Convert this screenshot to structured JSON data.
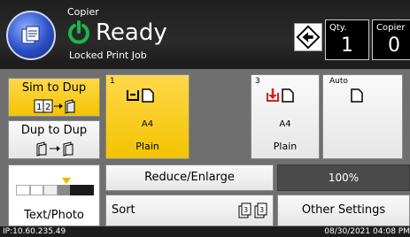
{
  "header": {
    "app_title": "Copier",
    "status": "Ready",
    "sub_status": "Locked Print Job",
    "qty_label": "Qty.",
    "qty_value": "1",
    "copier_label": "Copier",
    "copier_value": "0"
  },
  "duplex": {
    "sim_label": "Sim to Dup",
    "dup_label": "Dup to Dup"
  },
  "trays": [
    {
      "number": "1",
      "size": "A4",
      "type": "Plain"
    },
    {
      "number": "3",
      "size": "A4",
      "type": "Plain"
    },
    {
      "label": "Auto"
    }
  ],
  "density": {
    "label": "Text/Photo",
    "colors": [
      "#ffffff",
      "#ffffff",
      "#f0f0f0",
      "#8a8a8a",
      "#1a1a1a",
      "#1a1a1a"
    ]
  },
  "reduce_enlarge": {
    "label": "Reduce/Enlarge",
    "zoom": "100%"
  },
  "sort": {
    "label": "Sort"
  },
  "other": {
    "label": "Other Settings"
  },
  "statusbar": {
    "ip": "IP:10.60.235.49",
    "datetime": "08/30/2021 04:08 PM"
  },
  "colors": {
    "accent": "#f3c400",
    "header_bg": "#232323",
    "panel_bg": "#6f6f6f",
    "zoom_bg": "#4a4a4a",
    "tray_icon_yellow": "#e0a800",
    "tray_icon_red": "#d62020",
    "ready_green": "#19b74a"
  }
}
